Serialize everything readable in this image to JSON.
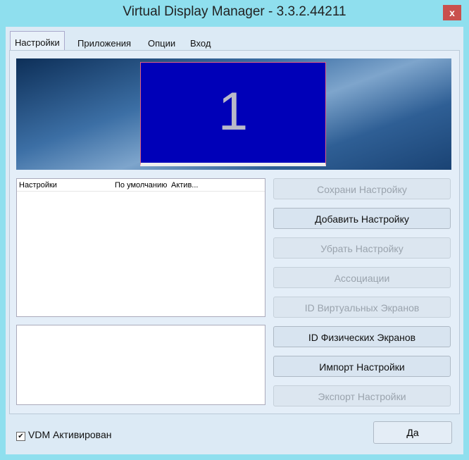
{
  "window": {
    "title": "Virtual Display Manager - 3.3.2.44211",
    "close": "x"
  },
  "tabs": [
    "Настройки",
    "Приложения",
    "Опции",
    "Вход"
  ],
  "monitor": {
    "number": "1"
  },
  "list": {
    "columns": [
      "Настройки",
      "По умолчанию",
      "Актив..."
    ]
  },
  "buttons": [
    {
      "label": "Сохрани Настройку",
      "enabled": false
    },
    {
      "label": "Добавить Настройку",
      "enabled": true
    },
    {
      "label": "Убрать Настройку",
      "enabled": false
    },
    {
      "label": "Ассоциации",
      "enabled": false
    },
    {
      "label": "ID Виртуальных Экранов",
      "enabled": false
    },
    {
      "label": "ID Физических Экранов",
      "enabled": true
    },
    {
      "label": "Импорт Настройки",
      "enabled": true
    },
    {
      "label": "Экспорт Настройки",
      "enabled": false
    }
  ],
  "footer": {
    "checkbox_label": "VDM Активирован",
    "checked": "✔",
    "ok": "Да"
  }
}
